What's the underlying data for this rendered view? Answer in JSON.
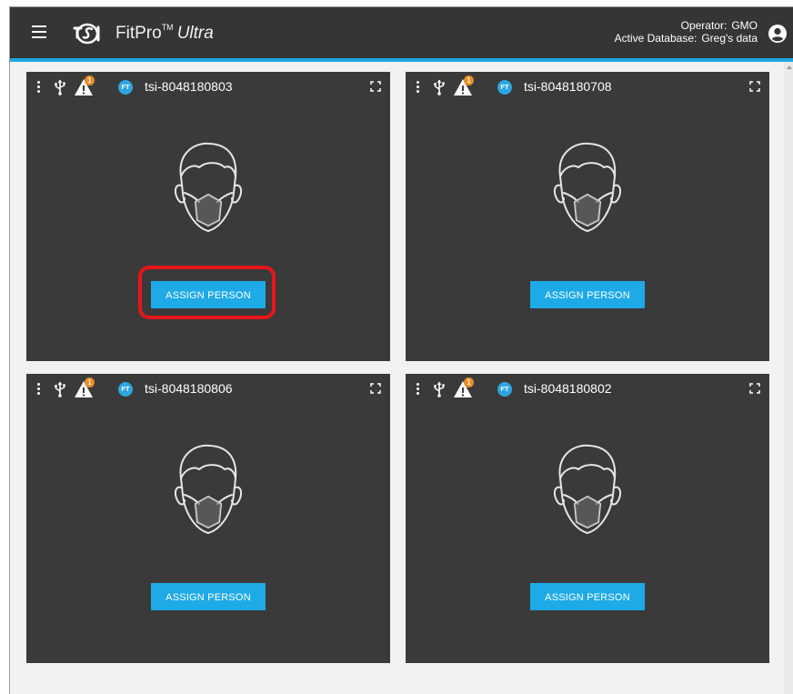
{
  "app": {
    "brand_name": "FitPro",
    "brand_tm": "TM",
    "brand_suffix": "Ultra",
    "operator_label": "Operator:",
    "operator_value": "GMO",
    "database_label": "Active Database:",
    "database_value": "Greg's data"
  },
  "colors": {
    "appbar": "#353535",
    "accent": "#1ea7df",
    "panel": "#3a3a3a",
    "button": "#1eaae6",
    "warning_badge": "#f08a24",
    "highlight": "#e8151b"
  },
  "panels": [
    {
      "device_id": "tsi-8048180803",
      "warning_count": "1",
      "mode_badge": "FT",
      "button_label": "ASSIGN PERSON",
      "highlighted": true
    },
    {
      "device_id": "tsi-8048180708",
      "warning_count": "1",
      "mode_badge": "FT",
      "button_label": "ASSIGN PERSON",
      "highlighted": false
    },
    {
      "device_id": "tsi-8048180806",
      "warning_count": "1",
      "mode_badge": "FT",
      "button_label": "ASSIGN PERSON",
      "highlighted": false
    },
    {
      "device_id": "tsi-8048180802",
      "warning_count": "1",
      "mode_badge": "FT",
      "button_label": "ASSIGN PERSON",
      "highlighted": false
    }
  ],
  "icons": [
    "menu-icon",
    "tsi-logo-icon",
    "account-icon",
    "kebab-menu-icon",
    "usb-icon",
    "warning-icon",
    "ft-mode-icon",
    "expand-icon",
    "person-mask-icon"
  ]
}
